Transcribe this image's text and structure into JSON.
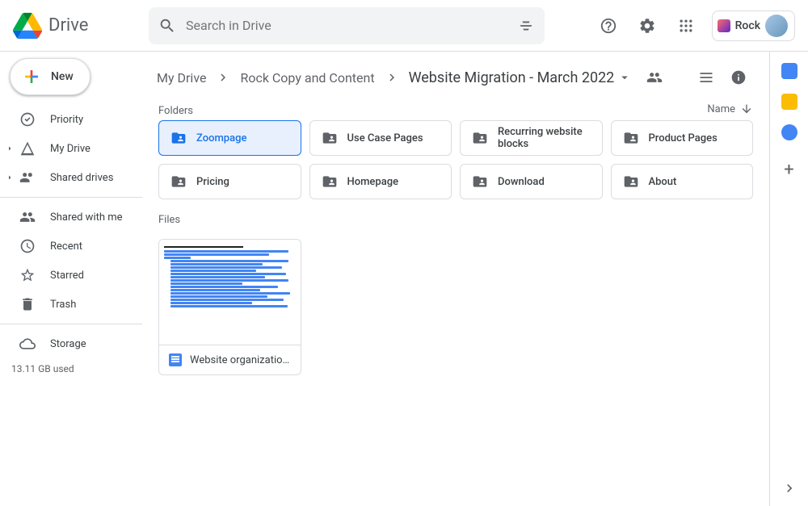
{
  "brand": "Drive",
  "search": {
    "placeholder": "Search in Drive"
  },
  "account": {
    "name": "Rock"
  },
  "new_button": "New",
  "nav": {
    "priority": "Priority",
    "mydrive": "My Drive",
    "shared_drives": "Shared drives",
    "shared_with_me": "Shared with me",
    "recent": "Recent",
    "starred": "Starred",
    "trash": "Trash",
    "storage": "Storage",
    "storage_used": "13.11 GB used"
  },
  "breadcrumb": {
    "items": [
      "My Drive",
      "Rock Copy and Content"
    ],
    "current": "Website Migration - March 2022"
  },
  "sort": {
    "label": "Name"
  },
  "sections": {
    "folders": "Folders",
    "files": "Files"
  },
  "folders": [
    {
      "name": "Zoompage",
      "selected": true
    },
    {
      "name": "Use Case Pages",
      "selected": false
    },
    {
      "name": "Recurring website blocks",
      "selected": false
    },
    {
      "name": "Product Pages",
      "selected": false
    },
    {
      "name": "Pricing",
      "selected": false
    },
    {
      "name": "Homepage",
      "selected": false
    },
    {
      "name": "Download",
      "selected": false
    },
    {
      "name": "About",
      "selected": false
    }
  ],
  "files": [
    {
      "name": "Website organization and as...",
      "type": "gdoc"
    }
  ]
}
